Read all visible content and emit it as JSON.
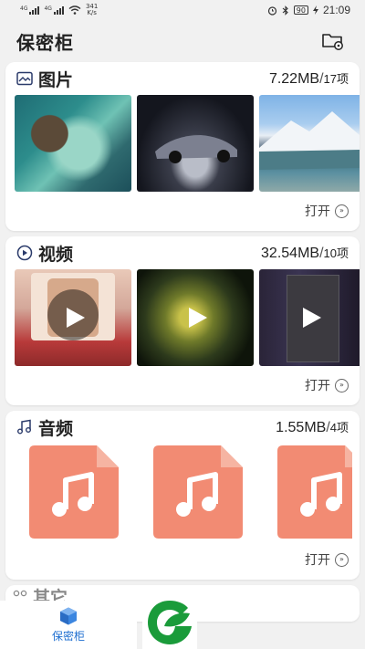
{
  "status_bar": {
    "net1": "4G",
    "net2": "4G",
    "speed_value": "341",
    "speed_unit": "K/s",
    "battery": "90",
    "time": "21:09"
  },
  "header": {
    "title": "保密柜"
  },
  "sections": {
    "images": {
      "title": "图片",
      "size": "7.22MB",
      "separator": "/",
      "count": "17项",
      "open_label": "打开"
    },
    "videos": {
      "title": "视频",
      "size": "32.54MB",
      "separator": "/",
      "count": "10项",
      "open_label": "打开"
    },
    "audio": {
      "title": "音频",
      "size": "1.55MB",
      "separator": "/",
      "count": "4项",
      "open_label": "打开"
    },
    "other": {
      "title": "其它"
    }
  },
  "bottom_nav": {
    "label": "保密柜"
  },
  "colors": {
    "accent": "#1f6fd0",
    "audio_doc": "#f28b73",
    "logo_green": "#1a9b3a"
  }
}
